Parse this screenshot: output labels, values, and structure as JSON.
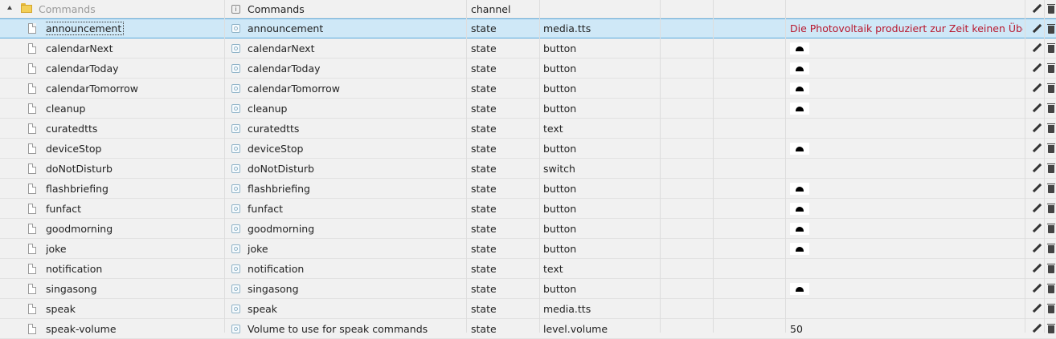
{
  "header": {
    "folder_name": "Commands",
    "common_name": "Commands",
    "type": "channel"
  },
  "rows": [
    {
      "id": "announcement",
      "name": "announcement",
      "type": "state",
      "role": "media.tts",
      "value": "Die Photovoltaik produziert zur Zeit keinen Übersc",
      "value_kind": "text"
    },
    {
      "id": "calendarNext",
      "name": "calendarNext",
      "type": "state",
      "role": "button",
      "value": "",
      "value_kind": "button"
    },
    {
      "id": "calendarToday",
      "name": "calendarToday",
      "type": "state",
      "role": "button",
      "value": "",
      "value_kind": "button"
    },
    {
      "id": "calendarTomorrow",
      "name": "calendarTomorrow",
      "type": "state",
      "role": "button",
      "value": "",
      "value_kind": "button"
    },
    {
      "id": "cleanup",
      "name": "cleanup",
      "type": "state",
      "role": "button",
      "value": "",
      "value_kind": "button"
    },
    {
      "id": "curatedtts",
      "name": "curatedtts",
      "type": "state",
      "role": "text",
      "value": "",
      "value_kind": "none"
    },
    {
      "id": "deviceStop",
      "name": "deviceStop",
      "type": "state",
      "role": "button",
      "value": "",
      "value_kind": "button"
    },
    {
      "id": "doNotDisturb",
      "name": "doNotDisturb",
      "type": "state",
      "role": "switch",
      "value": "",
      "value_kind": "none"
    },
    {
      "id": "flashbriefing",
      "name": "flashbriefing",
      "type": "state",
      "role": "button",
      "value": "",
      "value_kind": "button"
    },
    {
      "id": "funfact",
      "name": "funfact",
      "type": "state",
      "role": "button",
      "value": "",
      "value_kind": "button"
    },
    {
      "id": "goodmorning",
      "name": "goodmorning",
      "type": "state",
      "role": "button",
      "value": "",
      "value_kind": "button"
    },
    {
      "id": "joke",
      "name": "joke",
      "type": "state",
      "role": "button",
      "value": "",
      "value_kind": "button"
    },
    {
      "id": "notification",
      "name": "notification",
      "type": "state",
      "role": "text",
      "value": "",
      "value_kind": "none"
    },
    {
      "id": "singasong",
      "name": "singasong",
      "type": "state",
      "role": "button",
      "value": "",
      "value_kind": "button"
    },
    {
      "id": "speak",
      "name": "speak",
      "type": "state",
      "role": "media.tts",
      "value": "",
      "value_kind": "none"
    },
    {
      "id": "speak-volume",
      "name": "Volume to use for speak commands",
      "type": "state",
      "role": "level.volume",
      "value": "50",
      "value_kind": "text"
    }
  ],
  "selected_row": "announcement",
  "colors": {
    "selected_bg": "#cfe8f7",
    "value_red": "#b8182e"
  },
  "icons": {
    "expand": "collapse-triangle-icon",
    "folder": "folder-icon",
    "state": "state-icon",
    "channel_info": "info-icon",
    "edit": "pencil-icon",
    "delete": "trash-icon",
    "button_value": "button-push-icon"
  }
}
